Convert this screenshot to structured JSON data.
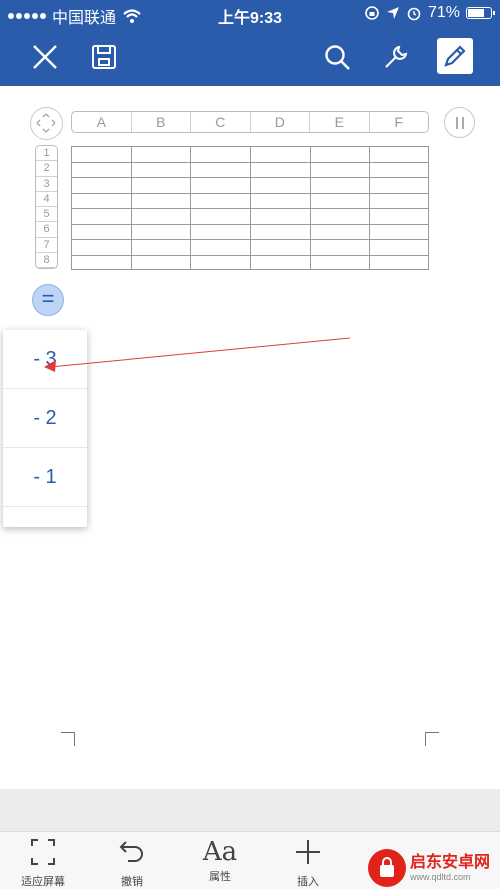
{
  "status_bar": {
    "carrier": "中国联通",
    "time": "上午9:33",
    "battery_text": "71%",
    "battery_level": 0.71,
    "wifi_icon": "wifi-icon",
    "location_icon": "location-arrow-icon",
    "alarm_icon": "alarm-icon",
    "rotation_icon": "rotation-lock-icon"
  },
  "toolbar": {
    "color": "#2a5cab",
    "icons": [
      "close-icon",
      "save-icon",
      "search-icon",
      "wrench-icon",
      "pen-icon"
    ]
  },
  "sheet": {
    "columns": [
      "A",
      "B",
      "C",
      "D",
      "E",
      "F"
    ],
    "rows": [
      "1",
      "2",
      "3",
      "4",
      "5",
      "6",
      "7",
      "8"
    ]
  },
  "equals_button": {
    "label": "="
  },
  "dropdown": {
    "items": [
      "- 3",
      "- 2",
      "- 1"
    ]
  },
  "annotation": {
    "color": "#e23b3b"
  },
  "bottom_bar": {
    "items": [
      {
        "label": "适应屏幕",
        "icon": "fit-screen-icon"
      },
      {
        "label": "撤销",
        "icon": "undo-icon"
      },
      {
        "label": "属性",
        "icon": "text-style-icon",
        "glyph": "Aa"
      },
      {
        "label": "插入",
        "icon": "plus-icon"
      }
    ]
  },
  "watermark": {
    "name": "启东安卓网",
    "url": "www.qdltd.com"
  }
}
